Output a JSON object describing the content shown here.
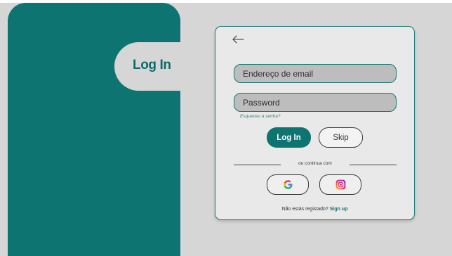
{
  "login_tab": {
    "label": "Log In"
  },
  "form": {
    "email": {
      "placeholder": "Endereço de email",
      "value": ""
    },
    "password": {
      "placeholder": "Password",
      "value": ""
    },
    "forgot_link": "Esqueceu a senha?",
    "login_button": "Log In",
    "skip_button": "Skip",
    "divider_text": "ou continua com",
    "social": [
      {
        "name": "Google",
        "icon": "google-icon"
      },
      {
        "name": "Instagram",
        "icon": "instagram-icon"
      }
    ],
    "signup": {
      "prompt": "Não estás registado?",
      "link": "Sign up"
    }
  },
  "colors": {
    "teal": "#0e7472",
    "background": "#d6d6d6",
    "card": "#e9e9e9",
    "field": "#bdbdbd"
  },
  "icons": {
    "back": "arrow-left-icon"
  }
}
